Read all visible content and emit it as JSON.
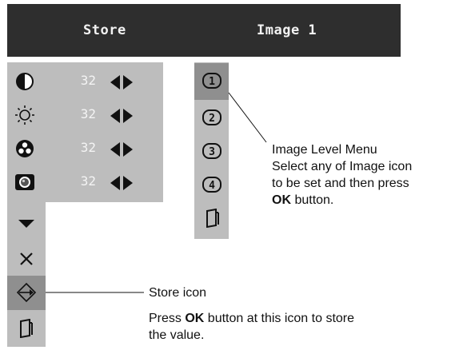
{
  "header": {
    "left_title": "Store",
    "right_title": "Image 1"
  },
  "store_menu": {
    "rows": [
      {
        "icon": "contrast-icon",
        "value": "32"
      },
      {
        "icon": "brightness-icon",
        "value": "32"
      },
      {
        "icon": "color-icon",
        "value": "32"
      },
      {
        "icon": "tint-icon",
        "value": "32"
      }
    ],
    "more_icon": "down-triangle-icon",
    "reset_icon": "close-icon",
    "store_icon": "store-icon",
    "exit_icon": "exit-door-icon"
  },
  "image_level_menu": {
    "items": [
      "1",
      "2",
      "3",
      "4"
    ],
    "exit_icon": "exit-door-icon"
  },
  "annotations": {
    "image_level_title": "Image Level Menu",
    "image_level_line1": "Select any of Image icon",
    "image_level_line2": "to be set and then press",
    "image_level_ok": "OK",
    "image_level_line3_rest": " button.",
    "store_bold": "Store",
    "store_rest": " icon",
    "store_desc_pre": "Press ",
    "store_desc_ok": "OK",
    "store_desc_post": " button at this icon to store",
    "store_desc_line2": "the value."
  },
  "colors": {
    "titlebar": "#2e2e2e",
    "menu_bg": "#bdbdbd",
    "highlight": "#8f8f8f",
    "number": "#f4f4f4"
  }
}
